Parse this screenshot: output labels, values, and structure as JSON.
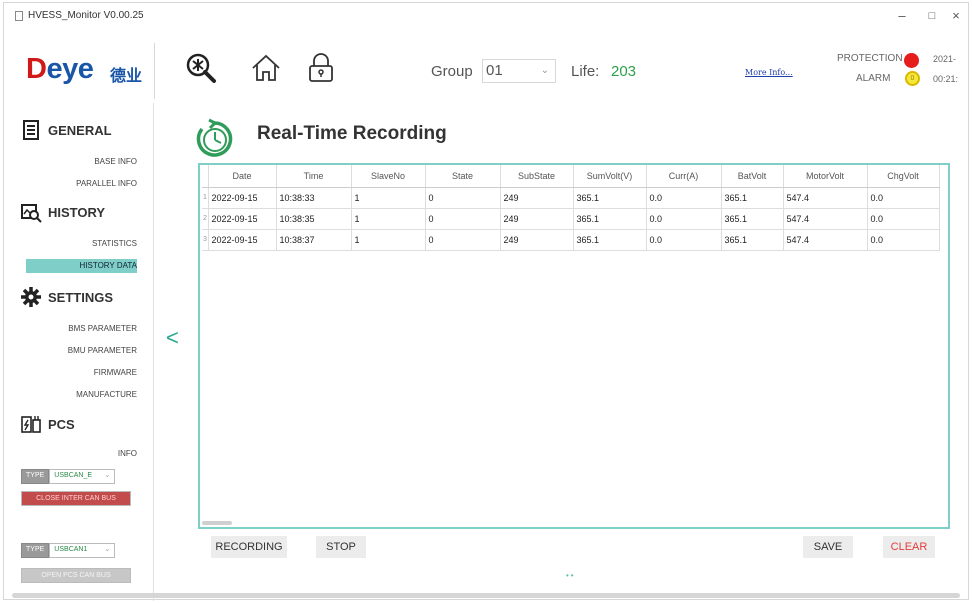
{
  "window": {
    "title": "HVESS_Monitor V0.00.25",
    "minimize": "–",
    "maximize": "□",
    "close": "×"
  },
  "header": {
    "logo_brand": "Deye",
    "logo_cn": "德业",
    "group_label": "Group",
    "group_value": "01",
    "life_label": "Life:",
    "life_value": "203",
    "more_info": "More Info...",
    "protection_label": "PROTECTION",
    "alarm_label": "ALARM",
    "alarm_led_text": "0",
    "date_partial": "2021-",
    "time_partial": "00:21:",
    "colors": {
      "protection": "#e51d1d",
      "alarm": "#f5e83a",
      "life": "#2da14a"
    }
  },
  "sidebar": {
    "general": "GENERAL",
    "base_info": "BASE INFO",
    "parallel_info": "PARALLEL INFO",
    "history": "HISTORY",
    "statistics": "STATISTICS",
    "history_data": "HISTORY DATA",
    "settings": "SETTINGS",
    "bms_parameter": "BMS PARAMETER",
    "bmu_parameter": "BMU PARAMETER",
    "firmware": "FIRMWARE",
    "manufacture": "MANUFACTURE",
    "pcs": "PCS",
    "info": "INFO",
    "type_label_1": "TYPE",
    "type_value_1": "USBCAN_E",
    "close_inter_can": "CLOSE INTER CAN BUS",
    "type_label_2": "TYPE",
    "type_value_2": "USBCAN1",
    "open_pcs_can": "OPEN PCS CAN BUS"
  },
  "main": {
    "back": "<",
    "title": "Real-Time Recording",
    "columns": [
      "Date",
      "Time",
      "SlaveNo",
      "State",
      "SubState",
      "SumVolt(V)",
      "Curr(A)",
      "BatVolt",
      "MotorVolt",
      "ChgVolt"
    ],
    "rows": [
      {
        "idx": "1",
        "cells": [
          "2022-09-15",
          "10:38:33",
          "1",
          "0",
          "249",
          "365.1",
          "0.0",
          "365.1",
          "547.4",
          "0.0"
        ]
      },
      {
        "idx": "2",
        "cells": [
          "2022-09-15",
          "10:38:35",
          "1",
          "0",
          "249",
          "365.1",
          "0.0",
          "365.1",
          "547.4",
          "0.0"
        ]
      },
      {
        "idx": "3",
        "cells": [
          "2022-09-15",
          "10:38:37",
          "1",
          "0",
          "249",
          "365.1",
          "0.0",
          "365.1",
          "547.4",
          "0.0"
        ]
      }
    ],
    "recording": "RECORDING",
    "stop": "STOP",
    "save": "SAVE",
    "clear": "CLEAR",
    "page_dots": "••"
  }
}
